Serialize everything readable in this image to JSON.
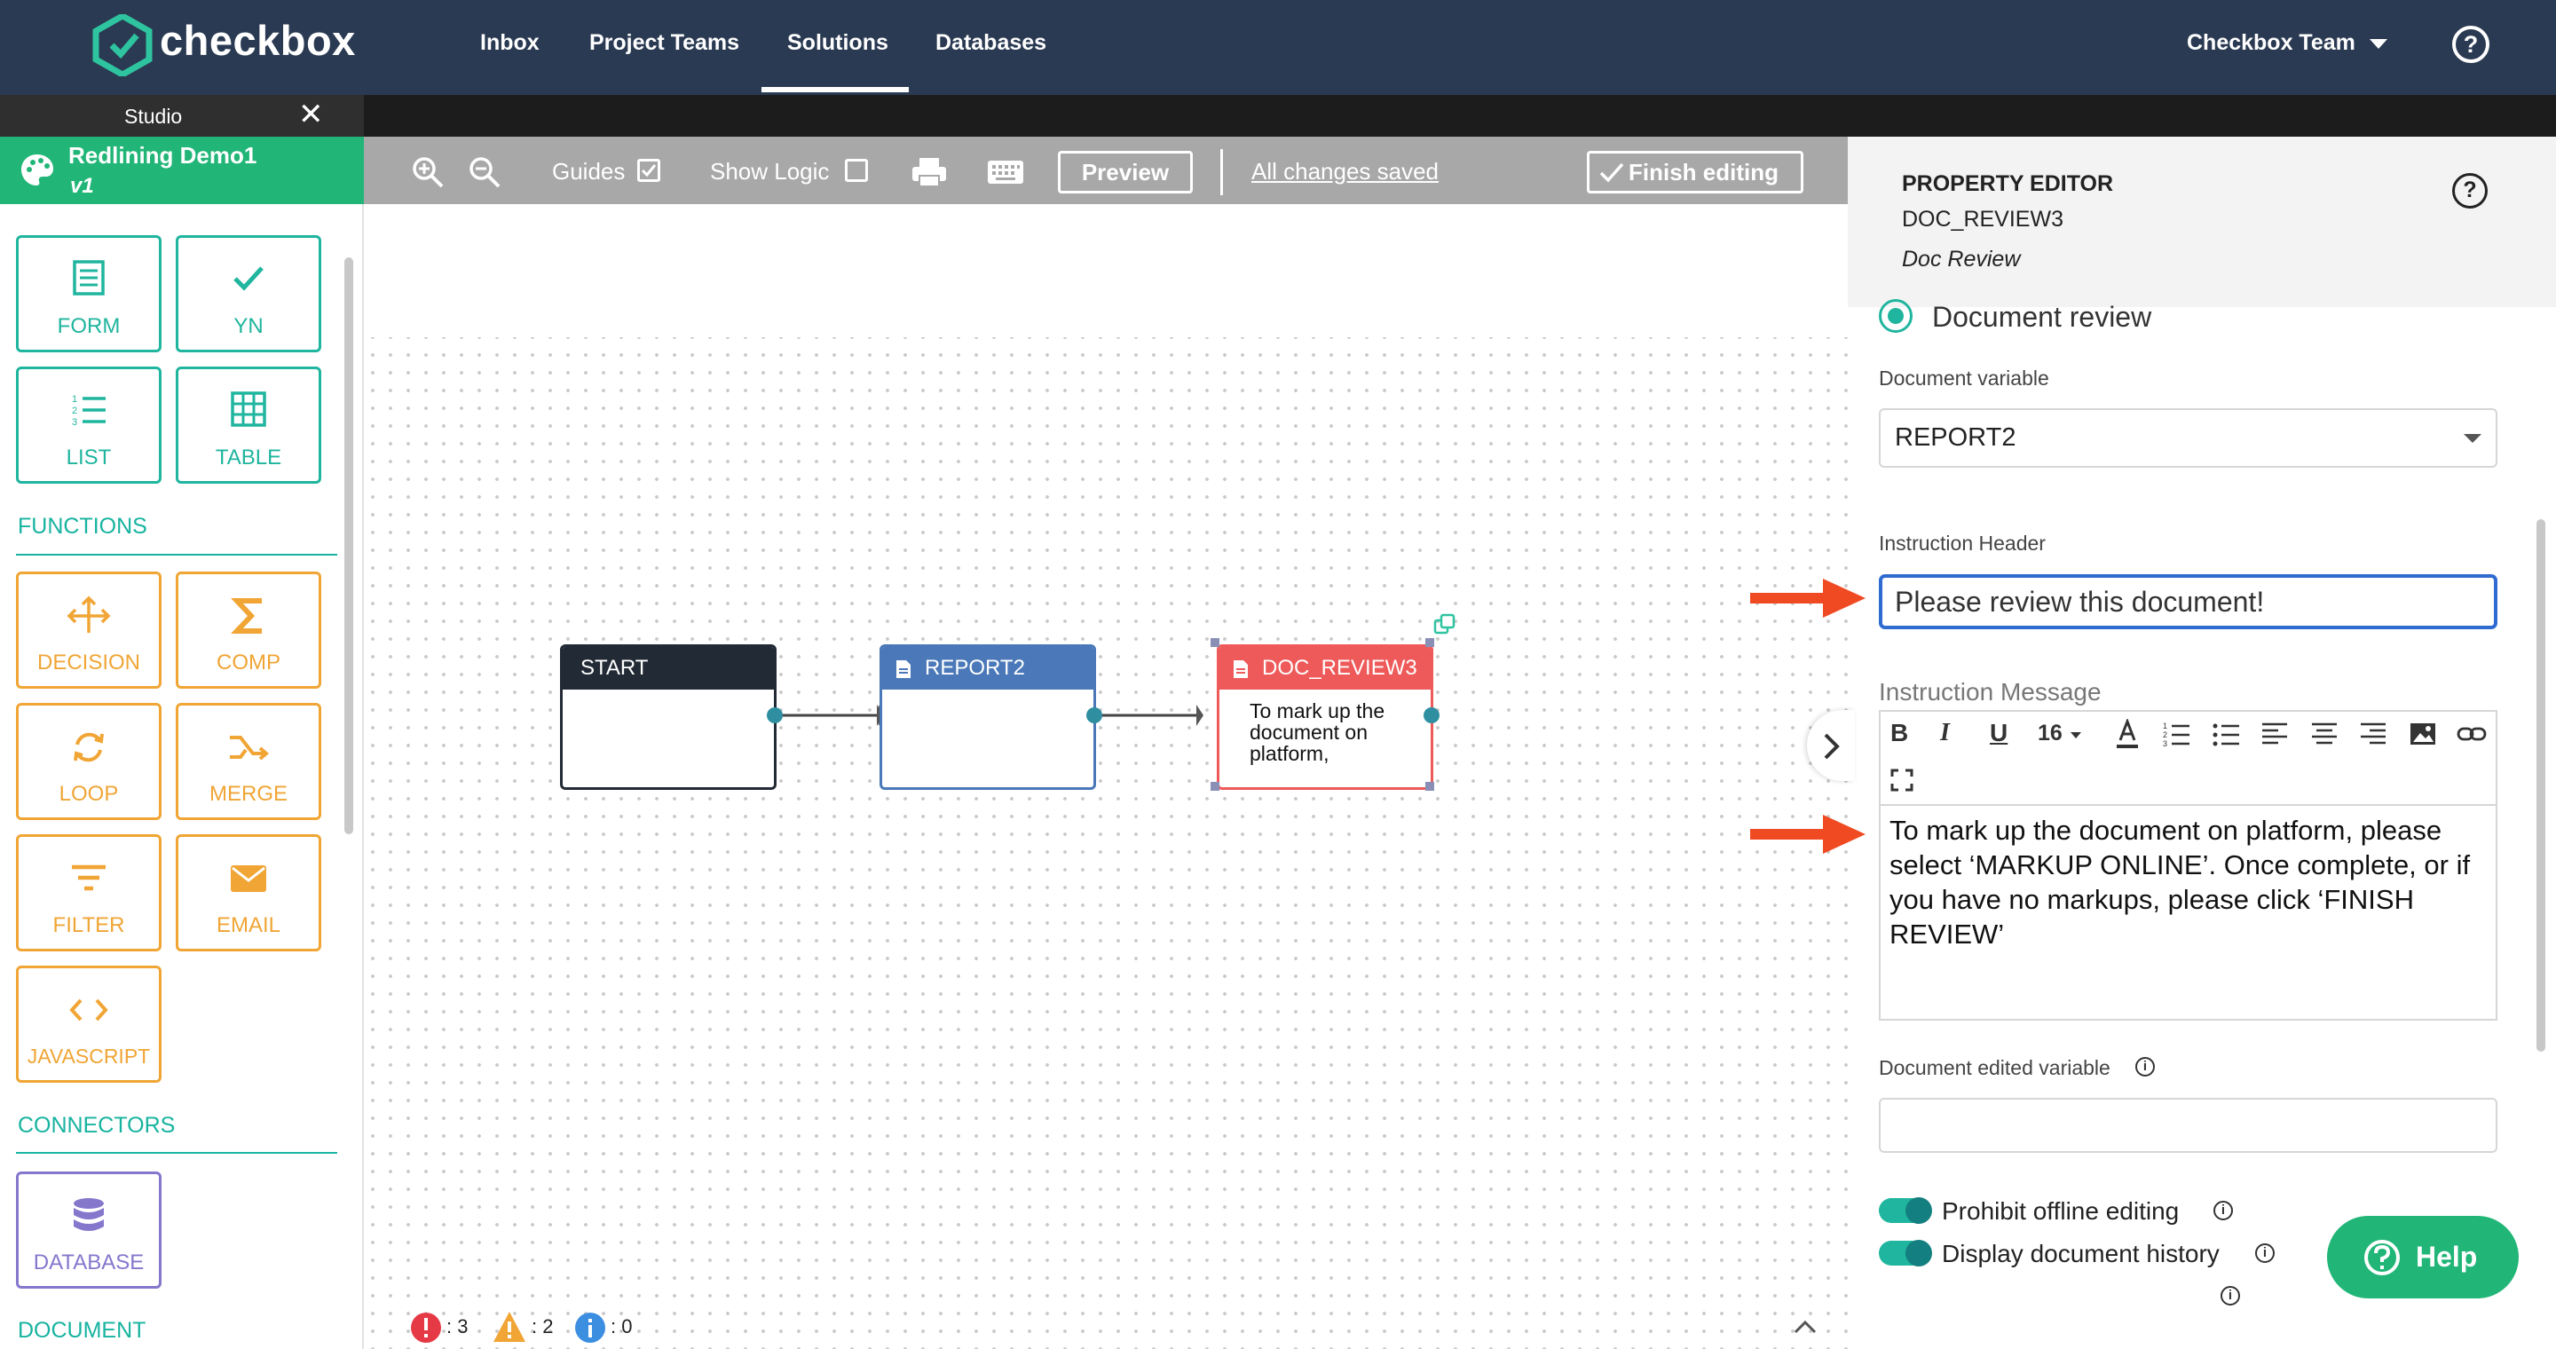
{
  "nav": {
    "brand": "checkbox",
    "links": [
      "Inbox",
      "Project Teams",
      "Solutions",
      "Databases"
    ],
    "active": "Solutions",
    "team": "Checkbox Team",
    "help_glyph": "?"
  },
  "studio": {
    "tab_label": "Studio",
    "close_glyph": "✕"
  },
  "project": {
    "name": "Redlining Demo1",
    "version": "v1"
  },
  "sidebar": {
    "tiles": [
      "FORM",
      "YN",
      "LIST",
      "TABLE"
    ],
    "functions_label": "FUNCTIONS",
    "functions": [
      "DECISION",
      "COMP",
      "LOOP",
      "MERGE",
      "FILTER",
      "EMAIL",
      "JAVASCRIPT"
    ],
    "connectors_label": "CONNECTORS",
    "connectors": [
      "DATABASE"
    ],
    "document_label": "DOCUMENT"
  },
  "toolbar": {
    "guides": "Guides",
    "show_logic": "Show Logic",
    "preview": "Preview",
    "saved": "All changes saved",
    "finish": "Finish editing"
  },
  "canvas": {
    "nodes": [
      {
        "label": "START",
        "color": "#222a35"
      },
      {
        "label": "REPORT2",
        "color": "#4a78b8"
      },
      {
        "label": "DOC_REVIEW3",
        "color": "#ee5a5a",
        "body": "To mark up the document on platform,"
      }
    ]
  },
  "status": {
    "errors": ": 3",
    "warnings": ": 2",
    "info": ": 0"
  },
  "property_editor": {
    "title": "PROPERTY EDITOR",
    "id": "DOC_REVIEW3",
    "type": "Doc Review",
    "mode": "Document review",
    "doc_var_label": "Document variable",
    "doc_var_value": "REPORT2",
    "instruction_header_label": "Instruction Header",
    "instruction_header_value": "Please review this document!",
    "instruction_message_label": "Instruction Message",
    "font_size": "16",
    "instruction_message_value": "To mark up the document on platform, please select ‘MARKUP ONLINE’. Once complete, or if you have no markups, please click ‘FINISH REVIEW’",
    "doc_edited_label": "Document edited variable",
    "toggle_offline": "Prohibit offline editing",
    "toggle_history": "Display document history"
  },
  "help_button": "Help",
  "colors": {
    "nav": "#2a3a52",
    "accent": "#21b677",
    "teal": "#1fb59e",
    "orange": "#f0a535",
    "purple": "#8477cc",
    "arrow": "#f04a23"
  }
}
